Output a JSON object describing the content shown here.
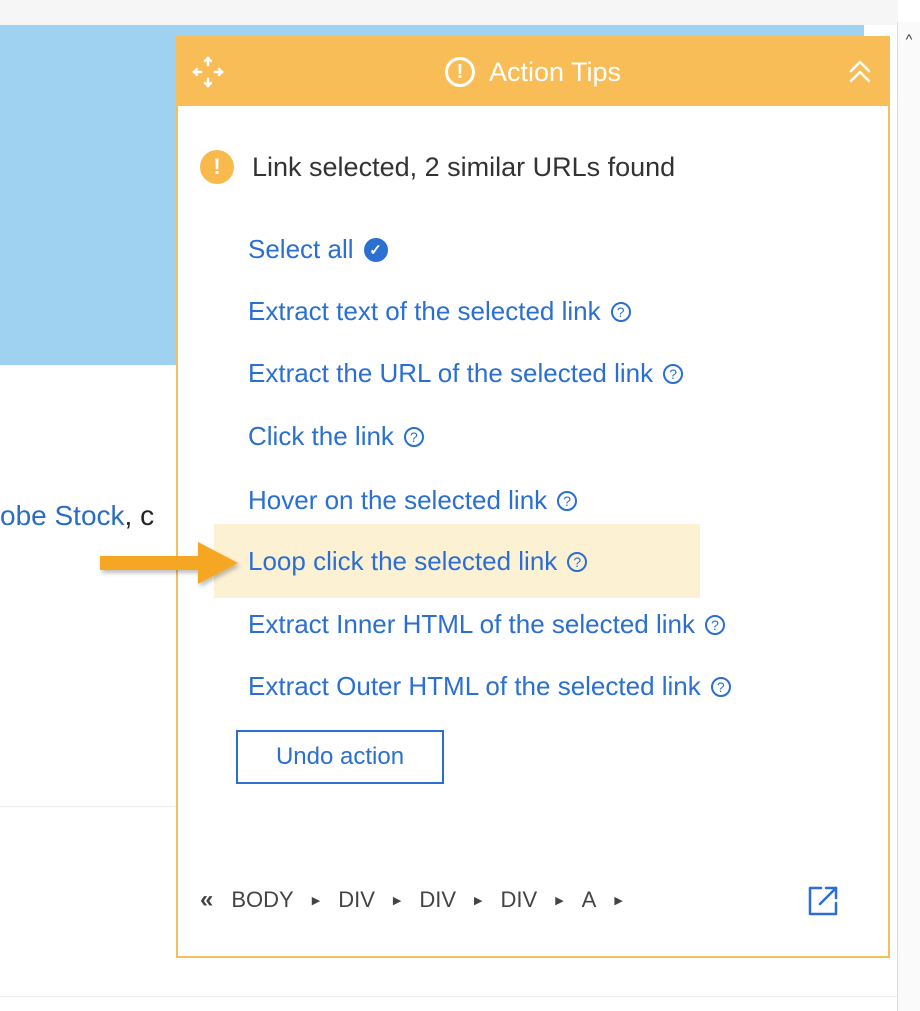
{
  "background": {
    "snippet_link": "obe Stock",
    "snippet_tail": ", c"
  },
  "panel": {
    "title": "Action Tips",
    "info_glyph": "!",
    "status_text": "Link selected, 2 similar URLs found",
    "status_glyph": "!",
    "actions": [
      {
        "label": "Select all",
        "icon": "check-circle-icon"
      },
      {
        "label": "Extract text of the selected link",
        "icon": "help-circle-icon"
      },
      {
        "label": "Extract the URL of the selected link",
        "icon": "help-circle-icon"
      },
      {
        "label": "Click the link",
        "icon": "help-circle-icon"
      },
      {
        "label": "Hover on the selected link",
        "icon": "help-circle-icon"
      },
      {
        "label": "Loop click the selected link",
        "icon": "help-circle-icon",
        "highlighted": true
      },
      {
        "label": "Extract Inner HTML of the selected link",
        "icon": "help-circle-icon"
      },
      {
        "label": "Extract Outer HTML of the selected link",
        "icon": "help-circle-icon"
      }
    ],
    "undo_label": "Undo action",
    "breadcrumb": {
      "back_glyph": "«",
      "items": [
        "BODY",
        "DIV",
        "DIV",
        "DIV",
        "A"
      ]
    }
  },
  "colors": {
    "header": "#f9bd57",
    "link": "#2a6fd1",
    "highlight": "#fdf1d4",
    "banner": "#9fd1f0",
    "pointer": "#f5a623"
  }
}
